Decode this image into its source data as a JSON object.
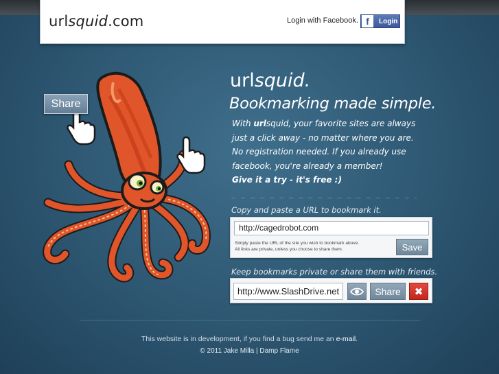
{
  "header": {
    "logo_prefix": "url",
    "logo_italic": "squid",
    "logo_suffix": ".com",
    "login_text": "Login with Facebook.",
    "login_button": "Login",
    "facebook_glyph": "f"
  },
  "hero": {
    "share_demo_label": "Share",
    "brand_prefix": "url",
    "brand_italic": "squid.",
    "tagline": "Bookmarking made simple.",
    "intro": {
      "l1_pre": "With ",
      "l1_brand": "url",
      "l1_mid": "squid, your favorite sites are always",
      "l2": "just a click away - no matter where you are.",
      "l3": "No registration needed. If you already use",
      "l4": "facebook, you're already a member!",
      "l5": "Give it a try - it's free :)"
    },
    "divider": "_ _ _ _ _ _ _ _ _ _ _ _ _ _ _ _ _ _ _ _ _ _ _ _ _ _"
  },
  "bookmark": {
    "label": "Copy and paste a URL to bookmark it.",
    "input_value": "http://cagedrobot.com",
    "help_line1": "Simply paste the URL of the site you wish to bookmark above.",
    "help_line2": "All links are private, unless you choose to share them.",
    "save_label": "Save"
  },
  "manage": {
    "label": "Keep bookmarks private or share them with friends.",
    "input_value": "http://www.SlashDrive.net",
    "view_icon": "eye-icon",
    "share_label": "Share",
    "delete_glyph": "✖"
  },
  "footer": {
    "line1_text": "This website is in development, if you find a bug send me an ",
    "line1_link": "e-mail",
    "line1_end": ".",
    "line2": "© 2011 Jake Milla | Damp Flame"
  },
  "colors": {
    "background": "#2d5671",
    "facebook": "#3b5998",
    "squid": "#e0552a",
    "delete": "#d2362b"
  }
}
